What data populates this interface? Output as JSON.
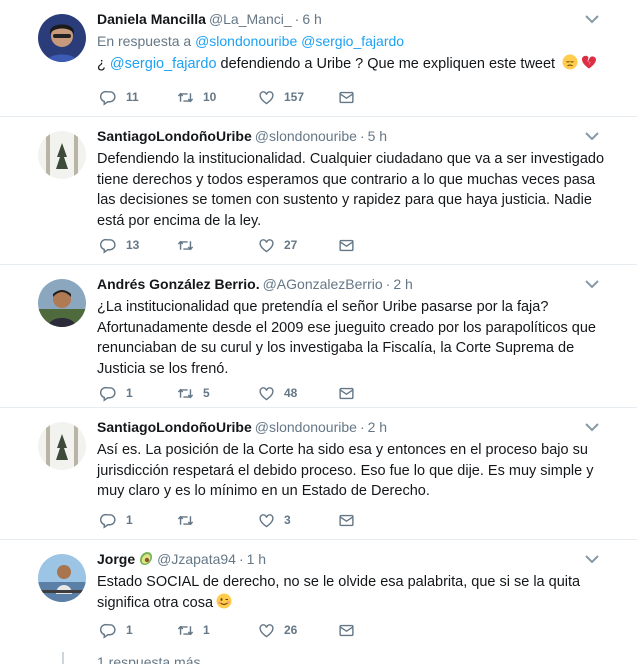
{
  "colors": {
    "link": "#1da1f2",
    "muted": "#657786",
    "text": "#14171a",
    "divider": "#e6ecf0"
  },
  "tweets": [
    {
      "name": "Daniela Mancilla",
      "handle": "@La_Manci_",
      "time": "6 h",
      "reply_prefix": "En respuesta a",
      "reply_users": "@slondonouribe @sergio_fajardo",
      "text_parts": [
        "¿ ",
        "@sergio_fajardo",
        " defendiendo a Uribe ? Que me expliquen este tweet"
      ],
      "emojis": [
        "disappointed-face-emoji",
        "broken-heart-emoji"
      ],
      "replies": "11",
      "retweets": "10",
      "likes": "157"
    },
    {
      "name": "SantiagoLondoñoUribe",
      "handle": "@slondonouribe",
      "time": "5 h",
      "text_lines": [
        "Defendiendo la institucionalidad.  Cualquier ciudadano que va a ser investigado",
        "tiene derechos y todos esperamos que contrario a lo que muchas veces pasa",
        "las decisiones se tomen con sustento y rapidez para que haya justicia. Nadie",
        "está por encima de la ley."
      ],
      "replies": "13",
      "retweets": "",
      "likes": "27"
    },
    {
      "name": "Andrés González Berrio.",
      "handle": "@AGonzalezBerrio",
      "time": "2 h",
      "text_lines": [
        "¿La institucionalidad que pretendía el señor Uribe pasarse por la faja?",
        "Afortunadamente desde el 2009 ese jueguito creado por los parapolíticos que",
        "renunciaban de su curul y los investigaba la Fiscalía, la Corte Suprema de",
        "Justicia se los frenó."
      ],
      "replies": "1",
      "retweets": "5",
      "likes": "48"
    },
    {
      "name": "SantiagoLondoñoUribe",
      "handle": "@slondonouribe",
      "time": "2 h",
      "text_lines": [
        "Así es. La posición de la Corte ha sido esa y entonces en el proceso bajo su",
        "jurisdicción respetará el debido proceso. Eso fue lo que dije. Es muy simple y",
        "muy claro y es lo mínimo en un Estado de Derecho."
      ],
      "replies": "1",
      "retweets": "",
      "likes": "3"
    },
    {
      "name": "Jorge",
      "name_emoji": "avocado-emoji",
      "handle": "@Jzapata94",
      "time": "1 h",
      "text_lines": [
        "Estado SOCIAL de derecho, no se le olvide esa palabrita, que si se la quita",
        "significa otra cosa"
      ],
      "emojis": [
        "winking-face-emoji"
      ],
      "replies": "1",
      "retweets": "1",
      "likes": "26"
    }
  ],
  "more_replies": "1 respuesta más"
}
